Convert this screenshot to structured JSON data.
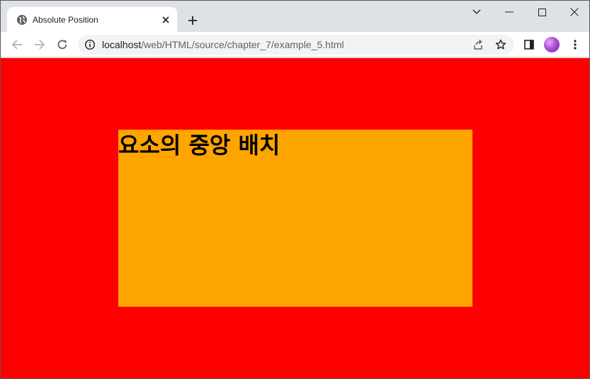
{
  "browser": {
    "tab": {
      "title": "Absolute Position",
      "favicon_icon": "globe-icon"
    },
    "address_bar": {
      "host": "localhost",
      "path": "/web/HTML/source/chapter_7/example_5.html"
    },
    "colors": {
      "tabstrip": "#dee1e6",
      "toolbar": "#ffffff"
    }
  },
  "page": {
    "background_color": "#ff0000",
    "box_color": "#ffa500",
    "heading": "요소의 중앙 배치"
  }
}
